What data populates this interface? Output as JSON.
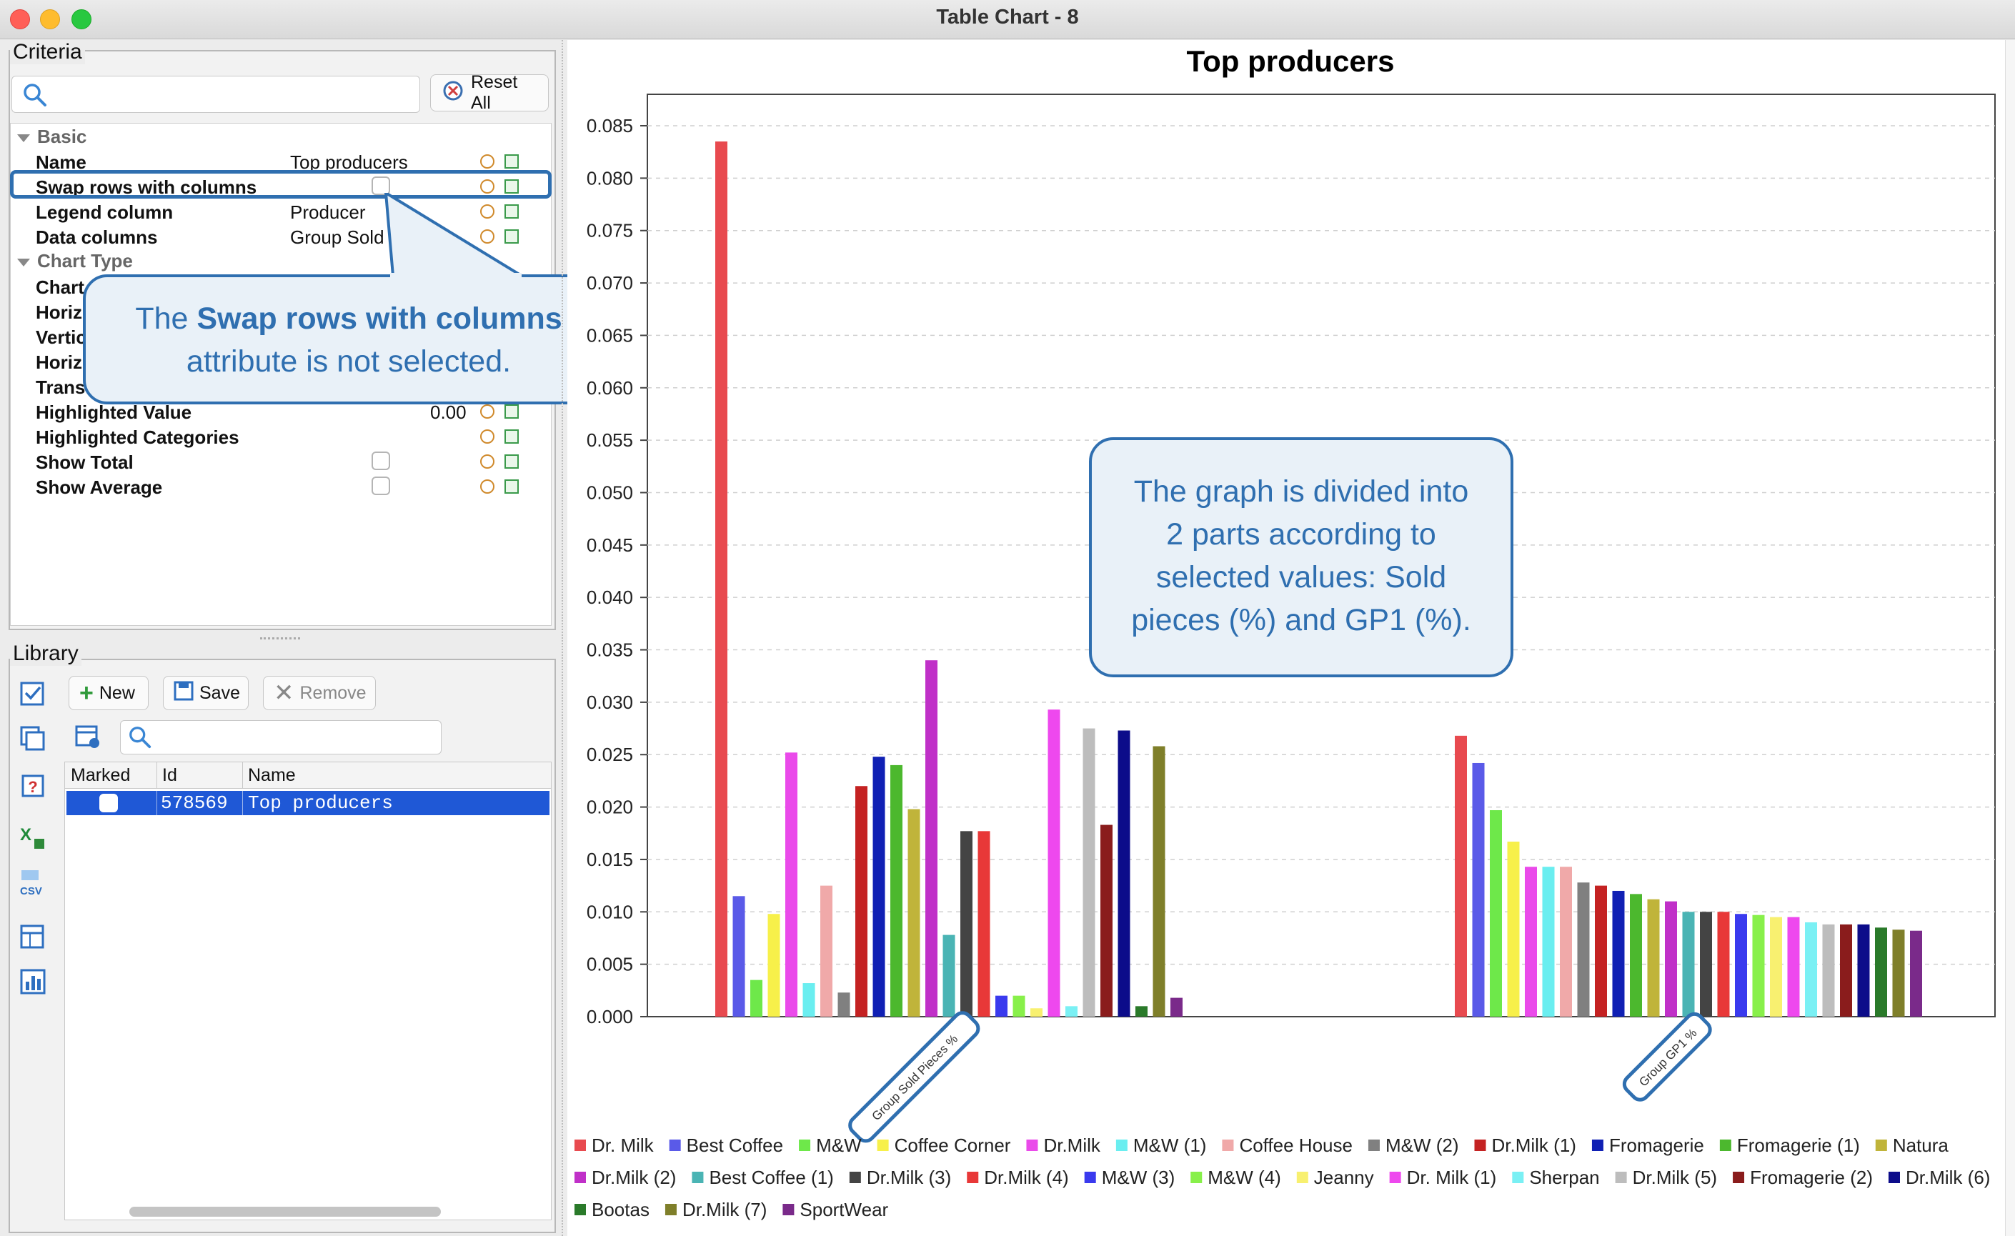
{
  "window": {
    "title": "Table Chart - 8"
  },
  "criteria": {
    "label": "Criteria",
    "search_placeholder": "",
    "reset_all": "Reset All",
    "sections": {
      "basic": "Basic",
      "chart_type": "Chart Type"
    },
    "rows": {
      "name": {
        "label": "Name",
        "value": "Top producers"
      },
      "swap": {
        "label": "Swap rows with columns"
      },
      "legend_column": {
        "label": "Legend column",
        "value": "Producer"
      },
      "data_columns": {
        "label": "Data columns",
        "value": "Group Sold"
      },
      "chart": "Chart",
      "horiz1": "Horiz",
      "vertic": "Vertic",
      "horiz2": "Horiz",
      "trans": "Trans",
      "highlighted_value": {
        "label": "Highlighted Value",
        "value": "0.00"
      },
      "highlighted_categories": "Highlighted Categories",
      "show_total": "Show Total",
      "show_average": "Show Average"
    }
  },
  "library": {
    "label": "Library",
    "buttons": {
      "new": "New",
      "save": "Save",
      "remove": "Remove"
    },
    "search_placeholder": "",
    "columns": {
      "marked": "Marked",
      "id": "Id",
      "name": "Name"
    },
    "selected_row": {
      "id": "578569",
      "name": "Top producers"
    }
  },
  "callouts": {
    "swap": {
      "prefix": "The ",
      "bold": "Swap rows with columns",
      "line2": "attribute is not selected."
    },
    "graph": {
      "lines": [
        "The graph is divided into",
        "2 parts according to",
        "selected values: Sold",
        "pieces (%) and GP1 (%)."
      ]
    }
  },
  "chart_data": {
    "type": "bar",
    "title": "Top producers",
    "xlabel": "",
    "ylabel": "",
    "ylim": [
      0,
      0.088
    ],
    "yticks": [
      "0.000",
      "0.005",
      "0.010",
      "0.015",
      "0.020",
      "0.025",
      "0.030",
      "0.035",
      "0.040",
      "0.045",
      "0.050",
      "0.055",
      "0.060",
      "0.065",
      "0.070",
      "0.075",
      "0.080",
      "0.085"
    ],
    "grid": true,
    "legend_position": "bottom",
    "categories": [
      "Group Sold Pieces %",
      "Group GP1 %"
    ],
    "series": [
      {
        "name": "Dr. Milk",
        "color": "#e84a4f",
        "values": [
          0.0835,
          0.0268
        ]
      },
      {
        "name": "Best Coffee",
        "color": "#5a5ae8",
        "values": [
          0.0115,
          0.0242
        ]
      },
      {
        "name": "M&W",
        "color": "#6ee84a",
        "values": [
          0.0035,
          0.0197
        ]
      },
      {
        "name": "Coffee Corner",
        "color": "#f7f04a",
        "values": [
          0.0098,
          0.0167
        ]
      },
      {
        "name": "Dr.Milk",
        "color": "#ea4aea",
        "values": [
          0.0252,
          0.0143
        ]
      },
      {
        "name": "M&W (1)",
        "color": "#6aeef0",
        "values": [
          0.0032,
          0.0143
        ]
      },
      {
        "name": "Coffee House",
        "color": "#f0a9a9",
        "values": [
          0.0125,
          0.0143
        ]
      },
      {
        "name": "M&W (2)",
        "color": "#808080",
        "values": [
          0.0023,
          0.0128
        ]
      },
      {
        "name": "Dr.Milk (1)",
        "color": "#c42222",
        "values": [
          0.022,
          0.0125
        ]
      },
      {
        "name": "Fromagerie",
        "color": "#1020b4",
        "values": [
          0.0248,
          0.012
        ]
      },
      {
        "name": "Fromagerie (1)",
        "color": "#4cb82e",
        "values": [
          0.024,
          0.0117
        ]
      },
      {
        "name": "Natura",
        "color": "#c0b43a",
        "values": [
          0.0198,
          0.0112
        ]
      },
      {
        "name": "Dr.Milk (2)",
        "color": "#c030c8",
        "values": [
          0.034,
          0.011
        ]
      },
      {
        "name": "Best Coffee (1)",
        "color": "#4ab4b4",
        "values": [
          0.0078,
          0.01
        ]
      },
      {
        "name": "Dr.Milk (3)",
        "color": "#444444",
        "values": [
          0.0177,
          0.01
        ]
      },
      {
        "name": "Dr.Milk (4)",
        "color": "#e83838",
        "values": [
          0.0177,
          0.01
        ]
      },
      {
        "name": "M&W (3)",
        "color": "#3a3aee",
        "values": [
          0.002,
          0.0098
        ]
      },
      {
        "name": "M&W (4)",
        "color": "#88f04a",
        "values": [
          0.002,
          0.0097
        ]
      },
      {
        "name": "Jeanny",
        "color": "#f8f070",
        "values": [
          0.0008,
          0.0095
        ]
      },
      {
        "name": "Dr. Milk (1)",
        "color": "#ee48ee",
        "values": [
          0.0293,
          0.0095
        ]
      },
      {
        "name": "Sherpan",
        "color": "#7af0f4",
        "values": [
          0.001,
          0.009
        ]
      },
      {
        "name": "Dr.Milk (5)",
        "color": "#bdbdbd",
        "values": [
          0.0275,
          0.0088
        ]
      },
      {
        "name": "Fromagerie (2)",
        "color": "#8a1c1c",
        "values": [
          0.0183,
          0.0088
        ]
      },
      {
        "name": "Dr.Milk (6)",
        "color": "#0c0c8a",
        "values": [
          0.0273,
          0.0088
        ]
      },
      {
        "name": "Bootas",
        "color": "#2a7a2a",
        "values": [
          0.001,
          0.0085
        ]
      },
      {
        "name": "Dr.Milk (7)",
        "color": "#7f7f2a",
        "values": [
          0.0258,
          0.0083
        ]
      },
      {
        "name": "SportWear",
        "color": "#7a2a8a",
        "values": [
          0.0018,
          0.0082
        ]
      }
    ]
  }
}
